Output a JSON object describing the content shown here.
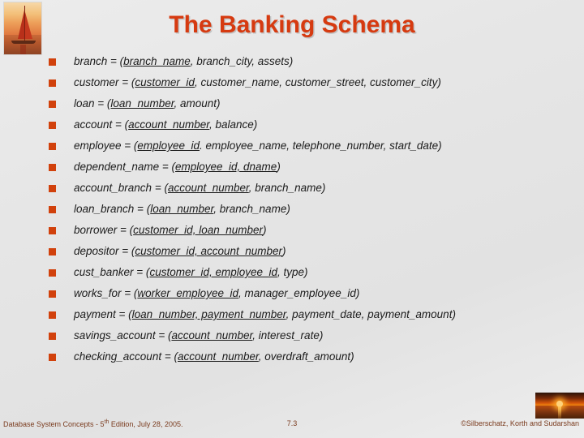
{
  "slide": {
    "title": "The Banking Schema",
    "accent_color": "#D63A10",
    "bullet_color": "#D1410C",
    "background_color": "#E7E7E7",
    "footer_text_color": "#7A3B1E"
  },
  "logo": {
    "name": "sailboat-sunset-photo"
  },
  "bullets": [
    {
      "relation": "branch",
      "text_plain": "branch = (branch_name, branch_city, assets)"
    },
    {
      "relation": "customer",
      "text_plain": "customer = (customer_id, customer_name, customer_street, customer_city)"
    },
    {
      "relation": "loan",
      "text_plain": "loan = (loan_number, amount)"
    },
    {
      "relation": "account",
      "text_plain": "account = (account_number, balance)"
    },
    {
      "relation": "employee",
      "text_plain": "employee = (employee_id. employee_name, telephone_number, start_date)"
    },
    {
      "relation": "dependent_name",
      "text_plain": "dependent_name = (employee_id, dname)"
    },
    {
      "relation": "account_branch",
      "text_plain": "account_branch = (account_number, branch_name)"
    },
    {
      "relation": "loan_branch",
      "text_plain": "loan_branch = (loan_number, branch_name)"
    },
    {
      "relation": "borrower",
      "text_plain": "borrower = (customer_id, loan_number)"
    },
    {
      "relation": "depositor",
      "text_plain": "depositor = (customer_id, account_number)"
    },
    {
      "relation": "cust_banker",
      "text_plain": "cust_banker = (customer_id, employee_id, type)"
    },
    {
      "relation": "works_for",
      "text_plain": "works_for = (worker_employee_id, manager_employee_id)"
    },
    {
      "relation": "payment",
      "text_plain": "payment = (loan_number, payment_number, payment_date, payment_amount)"
    },
    {
      "relation": "savings_account",
      "text_plain": "savings_account = (account_number, interest_rate)"
    },
    {
      "relation": "checking_account",
      "text_plain": "checking_account = (account_number, overdraft_amount)"
    }
  ],
  "bullet_parts": [
    {
      "pre": "branch = (",
      "key": "branch_name",
      "post": ", branch_city, assets)"
    },
    {
      "pre": "customer = (",
      "key": "customer_id",
      "post": ", customer_name, customer_street, customer_city)"
    },
    {
      "pre": "loan = (",
      "key": "loan_number",
      "post": ", amount)"
    },
    {
      "pre": "account = (",
      "key": "account_number",
      "post": ", balance)"
    },
    {
      "pre": "employee = (",
      "key": "employee_id",
      "post": ". employee_name, telephone_number, start_date)"
    },
    {
      "pre": "dependent_name = (",
      "key": "employee_id, dname",
      "post": ")"
    },
    {
      "pre": "account_branch = (",
      "key": "account_number",
      "post": ", branch_name)"
    },
    {
      "pre": "loan_branch = (",
      "key": "loan_number",
      "post": ", branch_name)"
    },
    {
      "pre": "borrower = (",
      "key": "customer_id, loan_number",
      "post": ")"
    },
    {
      "pre": "depositor = (",
      "key": "customer_id, account_number",
      "post": ")"
    },
    {
      "pre": "cust_banker = (",
      "key": "customer_id, employee_id",
      "post": ", type)"
    },
    {
      "pre": "works_for = (",
      "key": "worker_employee_id",
      "post": ", manager_employee_id)"
    },
    {
      "pre": "payment = (",
      "key": "loan_number, payment_number",
      "post": ", payment_date, payment_amount)"
    },
    {
      "pre": "savings_account = (",
      "key": "account_number",
      "post": ", interest_rate)"
    },
    {
      "pre": "checking_account = (",
      "key": "account_number",
      "post": ", overdraft_amount)"
    }
  ],
  "footer": {
    "left_prefix": "Database System Concepts - 5",
    "left_superscript": "th",
    "left_suffix": " Edition, July 28, 2005.",
    "page_number": "7.3",
    "copyright": "©Silberschatz, Korth and Sudarshan"
  }
}
